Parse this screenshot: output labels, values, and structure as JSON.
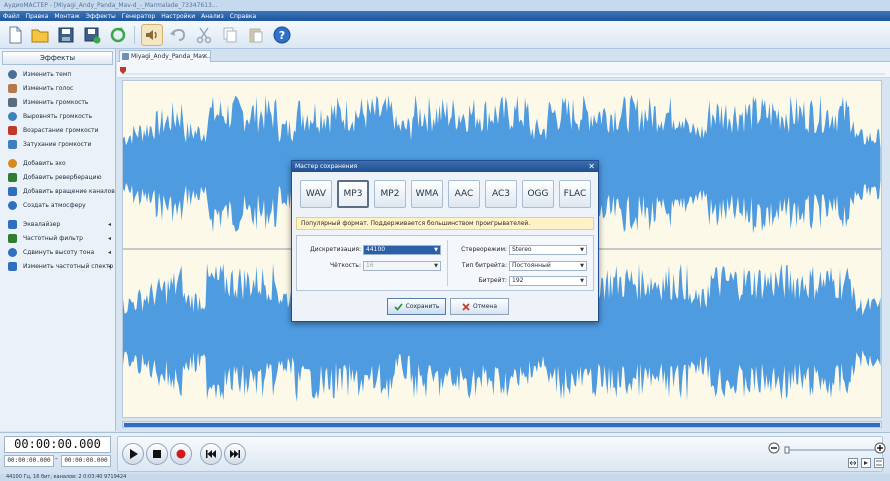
{
  "window": {
    "title": "АудиоМАСТЕР - [Miyagi_Andy_Panda_Mav-d_-_Marmalade_73347613..."
  },
  "menu": [
    "Файл",
    "Правка",
    "Монтаж",
    "Эффекты",
    "Генератор",
    "Настройки",
    "Анализ",
    "Справка"
  ],
  "toolbar": {
    "buttons": [
      "new-file",
      "open-folder",
      "save",
      "save-as",
      "refresh",
      "speaker",
      "undo",
      "cut",
      "copy",
      "paste",
      "help"
    ]
  },
  "sidebar": {
    "title": "Эффекты",
    "items": [
      {
        "label": "Изменить темп",
        "icon": "tempo-icon",
        "color": "#4a6f96"
      },
      {
        "label": "Изменить голос",
        "icon": "voice-icon",
        "color": "#b8794a"
      },
      {
        "label": "Изменить громкость",
        "icon": "volume-icon",
        "color": "#5b6c7e"
      },
      {
        "label": "Выровнять громкость",
        "icon": "level-volume-icon",
        "color": "#3e7fbf"
      },
      {
        "label": "Возрастание громкости",
        "icon": "fade-in-icon",
        "color": "#c0392b"
      },
      {
        "label": "Затухание громкости",
        "icon": "fade-out-icon",
        "color": "#3e7fbf"
      },
      {
        "label": "Добавить эхо",
        "icon": "echo-icon",
        "color": "#d68a1c"
      },
      {
        "label": "Добавить реверберацию",
        "icon": "reverb-icon",
        "color": "#2e7d32"
      },
      {
        "label": "Добавить вращение каналов",
        "icon": "rotate-channels-icon",
        "color": "#2f6fc0"
      },
      {
        "label": "Создать атмосферу",
        "icon": "atmosphere-icon",
        "color": "#2f6fc0"
      },
      {
        "label": "Эквалайзер",
        "icon": "equalizer-icon",
        "color": "#2f6fc0"
      },
      {
        "label": "Частотный фильтр",
        "icon": "filter-icon",
        "color": "#2e7d32"
      },
      {
        "label": "Сдвинуть высоту тона",
        "icon": "pitch-icon",
        "color": "#2f6fc0"
      },
      {
        "label": "Изменить частотный спектр",
        "icon": "spectrum-icon",
        "color": "#2f6fc0"
      }
    ]
  },
  "editor": {
    "tab_label": "Miyagi_Andy_Panda_Mav...",
    "wave_color": "#4f9be0",
    "background": "#fdf9e8"
  },
  "playback": {
    "time": "00:00:00.000",
    "selection_start": "00:00:00.000",
    "selection_separator": "-",
    "selection_end": "00:00:00.000"
  },
  "status": "44100 Гц, 16 бит, каналов: 2   0:03:40 9719424",
  "dialog": {
    "title": "Мастер сохранения",
    "formats": [
      "WAV",
      "MP3",
      "MP2",
      "WMA",
      "AAC",
      "AC3",
      "OGG",
      "FLAC"
    ],
    "selected_format": "MP3",
    "info": "Популярный формат. Поддерживается большинством проигрывателей.",
    "sample_rate": {
      "label": "Дискретизация:",
      "value": "44100"
    },
    "bit_depth": {
      "label": "Чёткость:",
      "value": "16"
    },
    "stereo_mode": {
      "label": "Стереорежим:",
      "value": "Stereo"
    },
    "bitrate_type": {
      "label": "Тип битрейта:",
      "value": "Постоянный"
    },
    "bitrate": {
      "label": "Битрейт:",
      "value": "192"
    },
    "save_label": "Сохранить",
    "cancel_label": "Отмена"
  }
}
